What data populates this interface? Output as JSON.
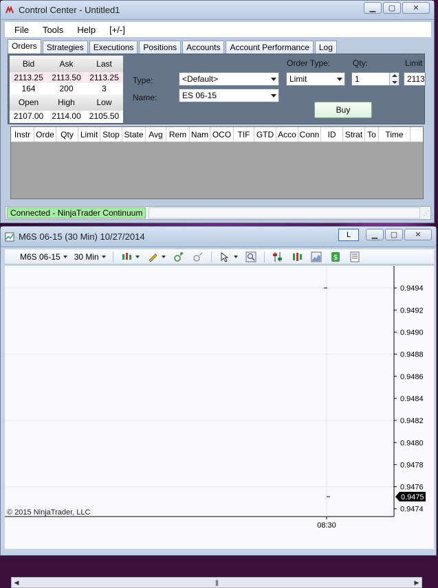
{
  "control_center": {
    "title": "Control Center - Untitled1",
    "menu": [
      "File",
      "Tools",
      "Help",
      "[+/-]"
    ],
    "tabs": [
      "Orders",
      "Strategies",
      "Executions",
      "Positions",
      "Accounts",
      "Account Performance",
      "Log"
    ],
    "active_tab": "Orders",
    "quote": {
      "headers": [
        "Bid",
        "Ask",
        "Last"
      ],
      "prices": [
        "2113.25",
        "2113.50",
        "2113.25"
      ],
      "sizes": [
        "164",
        "200",
        "3"
      ],
      "session_headers": [
        "Open",
        "High",
        "Low"
      ],
      "session_values": [
        "2107.00",
        "2114.00",
        "2105.50"
      ]
    },
    "order_entry": {
      "type_label": "Type:",
      "type_value": "<Default>",
      "name_label": "Name:",
      "name_value": "ES 06-15",
      "order_type_label": "Order Type:",
      "order_type_value": "Limit",
      "qty_label": "Qty:",
      "qty_value": "1",
      "limit_label": "Limit",
      "limit_value": "2113.",
      "buy_label": "Buy"
    },
    "grid_columns": [
      "Instr",
      "Orde",
      "Qty",
      "Limit",
      "Stop",
      "State",
      "Avg",
      "Rem",
      "Nam",
      "OCO",
      "TIF",
      "GTD",
      "Acco",
      "Conn",
      "ID",
      "Strat",
      "To",
      "Time"
    ],
    "status": "Connected - NinjaTrader Continuum"
  },
  "chart_window": {
    "title": "M6S 06-15 (30 Min)  10/27/2014",
    "l_button": "L",
    "toolbar": {
      "instrument": "M6S 06-15",
      "interval": "30 Min"
    },
    "copyright": "© 2015 NinjaTrader, LLC"
  },
  "chart_data": {
    "type": "line",
    "price_axis_ticks": [
      0.9494,
      0.9492,
      0.949,
      0.9488,
      0.9486,
      0.9484,
      0.9482,
      0.948,
      0.9478,
      0.9476,
      0.9474
    ],
    "price_axis_labels": [
      "0.9494",
      "0.9492",
      "0.9490",
      "0.9488",
      "0.9486",
      "0.9484",
      "0.9482",
      "0.9480",
      "0.9478",
      "0.9476",
      "0.9474"
    ],
    "ylim": [
      0.94733,
      0.9496
    ],
    "time_axis_labels": [
      "08:30"
    ],
    "bar": {
      "time": "08:30",
      "open": 0.9494,
      "close": 0.94751
    },
    "last_price": "0.9475",
    "grid": true
  },
  "colors": {
    "status_connected": "#a6eda6",
    "quote_highlight": "#fde9ee",
    "order_panel": "#65768a",
    "last_price_marker": "#000000"
  }
}
